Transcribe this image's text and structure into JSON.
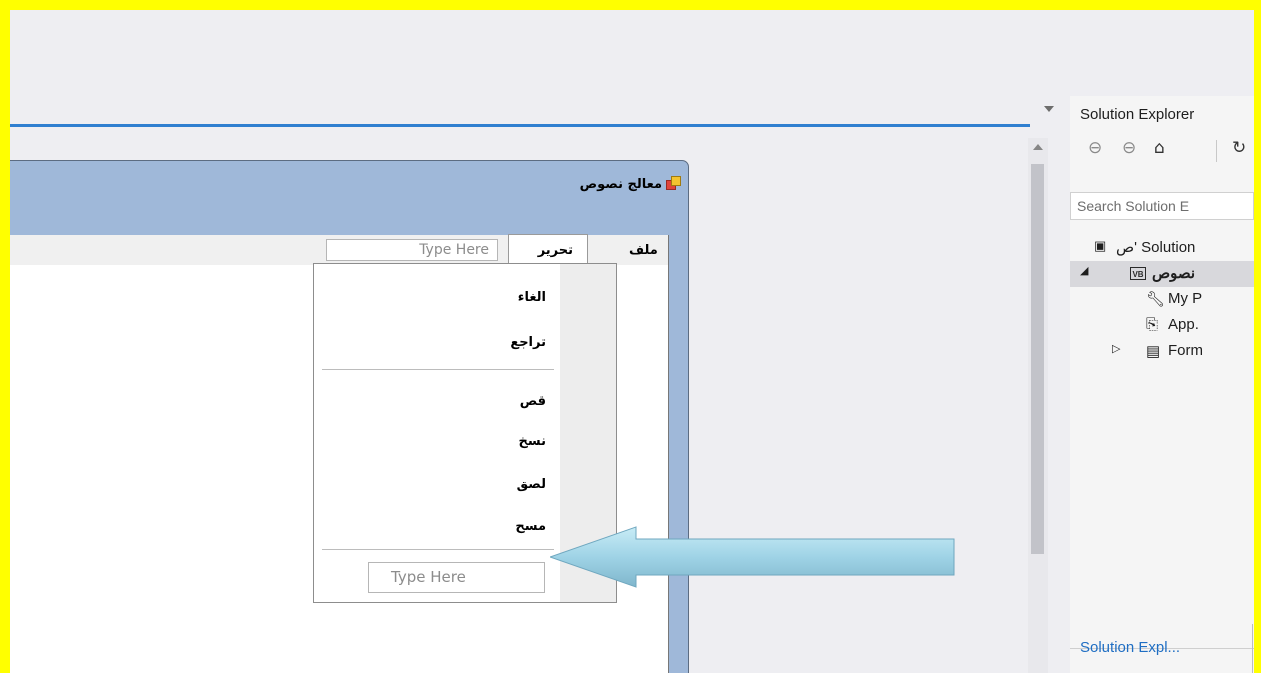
{
  "designer": {
    "form_title": "معالج نصوص",
    "menu_file": "ملف",
    "menu_edit": "تحرير",
    "type_here_top": "Type Here",
    "dropdown_items": [
      "الغاء",
      "تراجع",
      "قص",
      "نسخ",
      "لصق",
      "مسح"
    ],
    "type_here_bottom": "Type Here"
  },
  "solution_explorer": {
    "title": "Solution Explorer",
    "search_placeholder": "Search Solution E",
    "tree": {
      "solution": "ص' Solution",
      "project": "نصوص",
      "my_project": "My P",
      "app_config": "App.",
      "form": "Form"
    },
    "bottom_tab": "Solution Expl..."
  },
  "colors": {
    "frame": "#ffff00",
    "accent": "#2f7fd0",
    "arrow": "#9fd3e6"
  }
}
